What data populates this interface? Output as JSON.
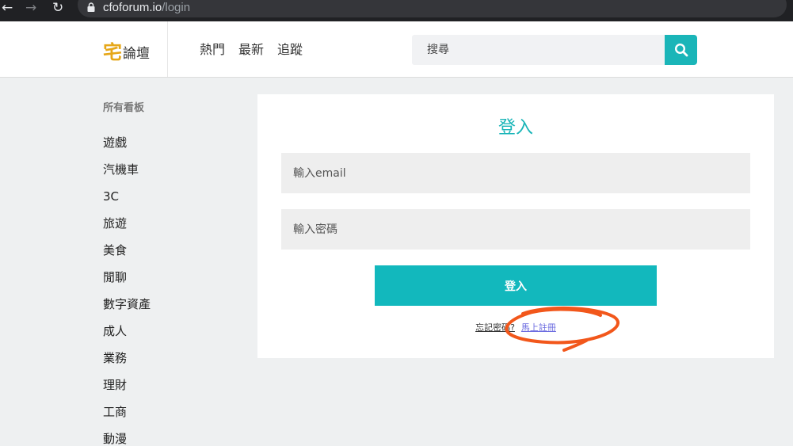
{
  "browser": {
    "url_host": "cfoforum.io",
    "url_path": "/login"
  },
  "header": {
    "logo_glyph": "宅",
    "logo_text": "論壇",
    "nav": [
      "熱門",
      "最新",
      "追蹤"
    ],
    "search_placeholder": "搜尋"
  },
  "sidebar": {
    "title": "所有看板",
    "items": [
      "遊戲",
      "汽機車",
      "3C",
      "旅遊",
      "美食",
      "閒聊",
      "數字資產",
      "成人",
      "業務",
      "理財",
      "工商",
      "動漫"
    ]
  },
  "login": {
    "title": "登入",
    "email_placeholder": "輸入email",
    "password_placeholder": "輸入密碼",
    "submit_label": "登入",
    "forgot_label": "忘記密碼?",
    "register_label": "馬上註冊"
  },
  "colors": {
    "accent": "#1ab5b8",
    "annotation": "#f2571b"
  }
}
